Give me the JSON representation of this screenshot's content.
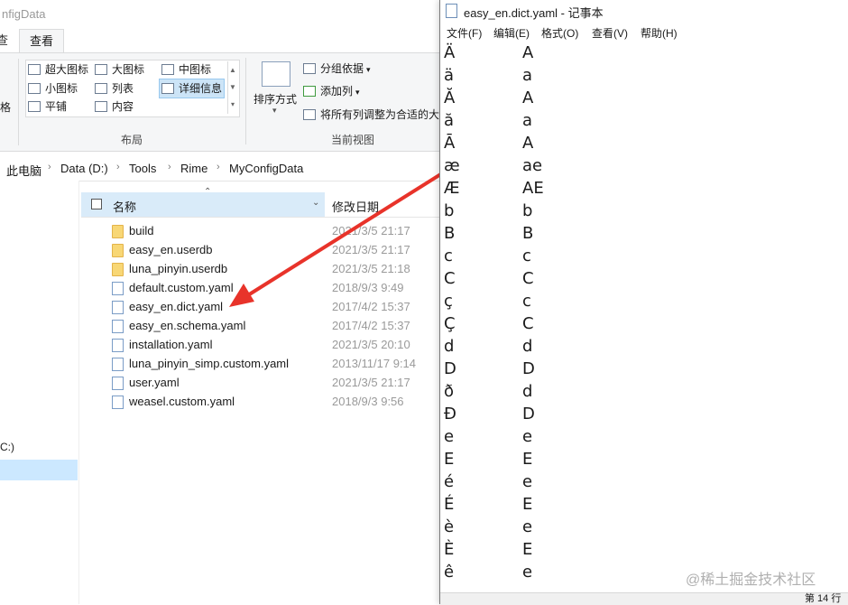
{
  "explorer": {
    "title": "nfigData",
    "tabs": {
      "left": "查",
      "active": "查看"
    },
    "layout_items": [
      "超大图标",
      "大图标",
      "中图标",
      "小图标",
      "列表",
      "详细信息",
      "平铺",
      "内容"
    ],
    "left_partial": "格",
    "sort_label": "排序方式",
    "group_by": "分组依据",
    "add_column": "添加列",
    "fit_columns": "将所有列调整为合适的大",
    "group_layout": "布局",
    "group_current_view": "当前视图",
    "breadcrumb": [
      "此电脑",
      "Data (D:)",
      "Tools",
      "Rime",
      "MyConfigData"
    ],
    "columns": {
      "name": "名称",
      "date": "修改日期"
    },
    "files": [
      {
        "name": "build",
        "date": "2021/3/5 21:17",
        "type": "folder"
      },
      {
        "name": "easy_en.userdb",
        "date": "2021/3/5 21:17",
        "type": "folder"
      },
      {
        "name": "luna_pinyin.userdb",
        "date": "2021/3/5 21:18",
        "type": "folder"
      },
      {
        "name": "default.custom.yaml",
        "date": "2018/9/3 9:49",
        "type": "file"
      },
      {
        "name": "easy_en.dict.yaml",
        "date": "2017/4/2 15:37",
        "type": "file"
      },
      {
        "name": "easy_en.schema.yaml",
        "date": "2017/4/2 15:37",
        "type": "file"
      },
      {
        "name": "installation.yaml",
        "date": "2021/3/5 20:10",
        "type": "file"
      },
      {
        "name": "luna_pinyin_simp.custom.yaml",
        "date": "2013/11/17 9:14",
        "type": "file"
      },
      {
        "name": "user.yaml",
        "date": "2021/3/5 21:17",
        "type": "file"
      },
      {
        "name": "weasel.custom.yaml",
        "date": "2018/9/3 9:56",
        "type": "file"
      }
    ],
    "nav_drive": "C:)"
  },
  "notepad": {
    "title": "easy_en.dict.yaml - 记事本",
    "menu": [
      "文件(F)",
      "编辑(E)",
      "格式(O)",
      "查看(V)",
      "帮助(H)"
    ],
    "lines": [
      [
        "Ä",
        "A"
      ],
      [
        "ä",
        "a"
      ],
      [
        "Ă",
        "A"
      ],
      [
        "ă",
        "a"
      ],
      [
        "Ā",
        "A"
      ],
      [
        "æ",
        "ae"
      ],
      [
        "Æ",
        "AE"
      ],
      [
        "b",
        "b"
      ],
      [
        "B",
        "B"
      ],
      [
        "c",
        "c"
      ],
      [
        "C",
        "C"
      ],
      [
        "ç",
        "c"
      ],
      [
        "Ç",
        "C"
      ],
      [
        "d",
        "d"
      ],
      [
        "D",
        "D"
      ],
      [
        "ð",
        "d"
      ],
      [
        "Đ",
        "D"
      ],
      [
        "e",
        "e"
      ],
      [
        "E",
        "E"
      ],
      [
        "é",
        "e"
      ],
      [
        "É",
        "E"
      ],
      [
        "è",
        "e"
      ],
      [
        "È",
        "E"
      ],
      [
        "ê",
        "e"
      ]
    ],
    "status": "第 14 行"
  },
  "watermark": "@稀土掘金技术社区",
  "colors": {
    "arrow": "#e8332a",
    "selection": "#cce4f7",
    "folder": "#f8d775"
  }
}
